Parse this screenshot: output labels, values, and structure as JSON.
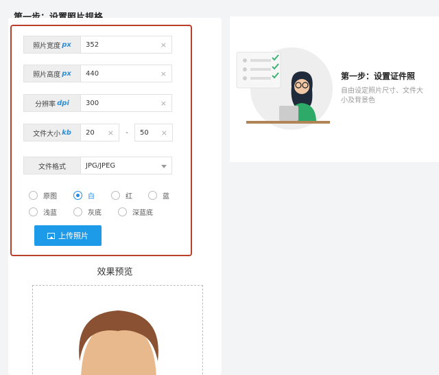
{
  "page": {
    "title": "第一步：设置照片规格"
  },
  "form": {
    "width": {
      "label": "照片宽度",
      "unit": "px",
      "value": "352"
    },
    "height": {
      "label": "照片高度",
      "unit": "px",
      "value": "440"
    },
    "dpi": {
      "label": "分辨率",
      "unit": "dpi",
      "value": "300"
    },
    "filesize": {
      "label": "文件大小",
      "unit": "kb",
      "min": "20",
      "separator": "-",
      "max": "50"
    },
    "format": {
      "label": "文件格式",
      "value": "JPG/JPEG"
    },
    "background_options": [
      {
        "label": "原图",
        "checked": false
      },
      {
        "label": "白",
        "checked": true
      },
      {
        "label": "红",
        "checked": false
      },
      {
        "label": "蓝",
        "checked": false
      },
      {
        "label": "浅蓝",
        "checked": false
      },
      {
        "label": "灰底",
        "checked": false
      },
      {
        "label": "深蓝底",
        "checked": false
      }
    ],
    "upload_label": "上传照片",
    "clear_icon": "×"
  },
  "preview": {
    "title": "效果预览"
  },
  "step_card": {
    "title": "第一步：设置证件照",
    "description": "自由设定照片尺寸、文件大小及背景色"
  },
  "colors": {
    "accent": "#1e9be8",
    "highlight_border": "#b8402b",
    "check_green": "#3cb371"
  }
}
